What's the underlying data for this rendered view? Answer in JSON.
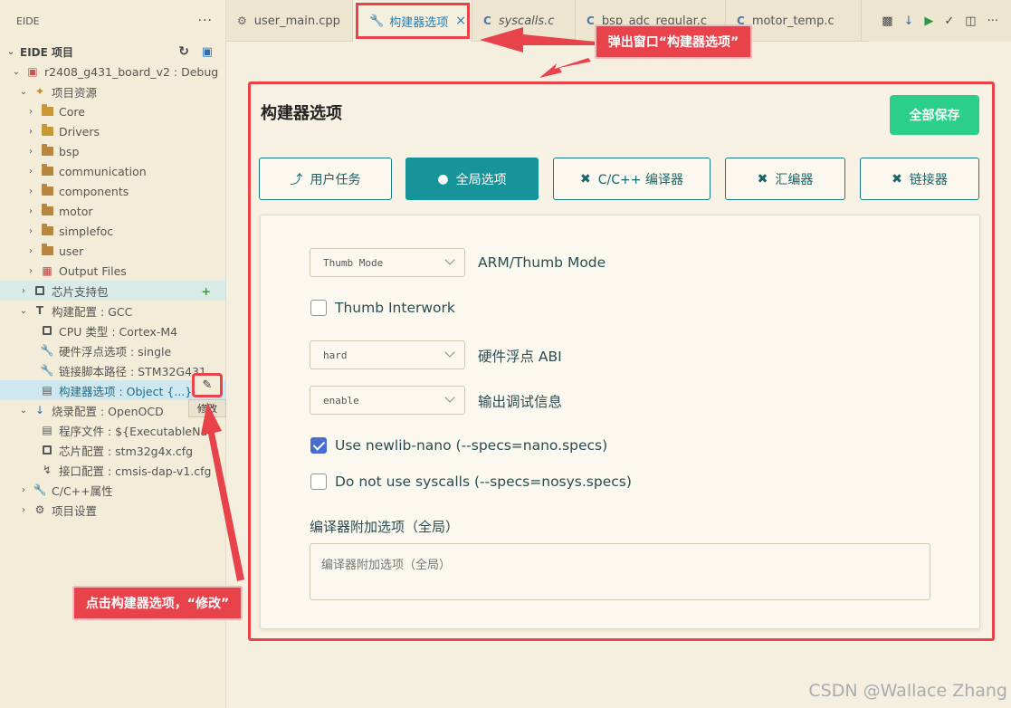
{
  "sidebar": {
    "header": "EIDE",
    "more": "···",
    "section": "EIDE 项目",
    "project": "r2408_g431_board_v2 : Debug",
    "resources": "项目资源",
    "folders": [
      "Core",
      "Drivers",
      "bsp",
      "communication",
      "components",
      "motor",
      "simplefoc",
      "user",
      "Output Files"
    ],
    "chip_pkg": "芯片支持包",
    "build_config": "构建配置 : GCC",
    "cpu_type": "CPU 类型 : Cortex-M4",
    "fpu": "硬件浮点选项 : single",
    "linker_script": "链接脚本路径 : STM32G431...",
    "builder_opts": "构建器选项 : Object {...}",
    "flash_config": "烧录配置 : OpenOCD",
    "program_file": "程序文件 : ${ExecutableNa",
    "chip_config": "芯片配置 : stm32g4x.cfg",
    "interface_config": "接口配置 : cmsis-dap-v1.cfg",
    "cpp_props": "C/C++属性",
    "project_settings": "项目设置",
    "edit_tooltip": "修改"
  },
  "tabs": [
    {
      "label": "user_main.cpp",
      "icon": "gear-icon"
    },
    {
      "label": "构建器选项",
      "icon": "wrench-icon"
    },
    {
      "label": "syscalls.c",
      "icon": "c-file-icon"
    },
    {
      "label": "bsp_adc_regular.c",
      "icon": "c-file-icon"
    },
    {
      "label": "motor_temp.c",
      "icon": "c-file-icon"
    }
  ],
  "panel": {
    "title": "构建器选项",
    "save_all": "全部保存",
    "nav": [
      "用户任务",
      "全局选项",
      "C/C++ 编译器",
      "汇编器",
      "链接器"
    ],
    "arm_mode_value": "Thumb Mode",
    "arm_mode_label": "ARM/Thumb Mode",
    "thumb_interwork": "Thumb Interwork",
    "float_abi_value": "hard",
    "float_abi_label": "硬件浮点 ABI",
    "debug_value": "enable",
    "debug_label": "输出调试信息",
    "newlib_nano": "Use newlib-nano (--specs=nano.specs)",
    "no_syscalls": "Do not use syscalls (--specs=nosys.specs)",
    "misc_label": "编译器附加选项（全局）",
    "misc_placeholder": "编译器附加选项（全局）"
  },
  "annotations": {
    "popup_note": "弹出窗口“构建器选项”",
    "click_note": "点击构建器选项，“修改”"
  },
  "watermark": "CSDN @Wallace Zhang",
  "colors": {
    "accent_red": "#e8424b",
    "teal": "#17949a",
    "save_green": "#2bcf8a",
    "checkbox_blue": "#4a6cd0"
  }
}
